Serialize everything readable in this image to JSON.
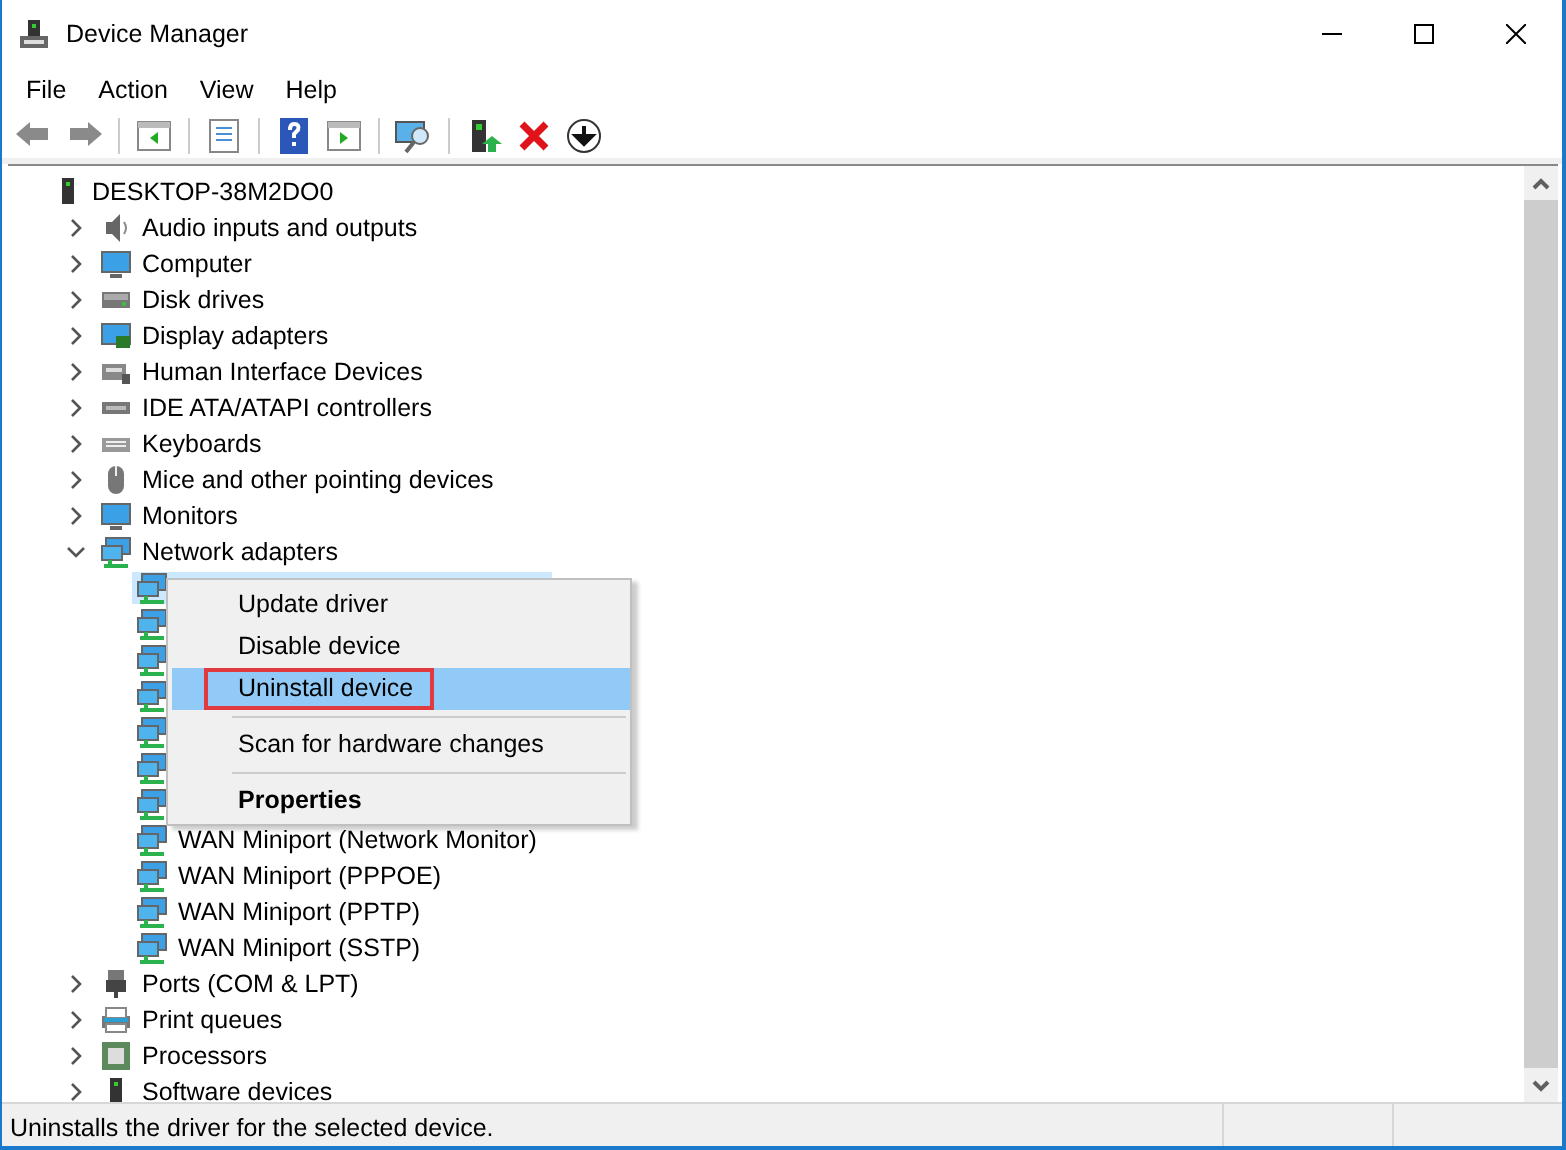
{
  "window": {
    "title": "Device Manager"
  },
  "menu": [
    "File",
    "Action",
    "View",
    "Help"
  ],
  "tree": {
    "label": "DESKTOP-38M2DO0",
    "children": [
      {
        "label": "Audio inputs and outputs",
        "expanded": false
      },
      {
        "label": "Computer",
        "expanded": false
      },
      {
        "label": "Disk drives",
        "expanded": false
      },
      {
        "label": "Display adapters",
        "expanded": false
      },
      {
        "label": "Human Interface Devices",
        "expanded": false
      },
      {
        "label": "IDE ATA/ATAPI controllers",
        "expanded": false
      },
      {
        "label": "Keyboards",
        "expanded": false
      },
      {
        "label": "Mice and other pointing devices",
        "expanded": false
      },
      {
        "label": "Monitors",
        "expanded": false
      },
      {
        "label": "Network adapters",
        "expanded": true,
        "children": [
          {
            "selected": true
          },
          {
            "selected": false
          },
          {
            "selected": false
          },
          {
            "selected": false
          },
          {
            "selected": false
          },
          {
            "selected": false
          },
          {
            "selected": false
          },
          {
            "label": "WAN Miniport (Network Monitor)",
            "selected": false
          },
          {
            "label": "WAN Miniport (PPPOE)",
            "selected": false
          },
          {
            "label": "WAN Miniport (PPTP)",
            "selected": false
          },
          {
            "label": "WAN Miniport (SSTP)",
            "selected": false
          }
        ]
      },
      {
        "label": "Ports (COM & LPT)",
        "expanded": false
      },
      {
        "label": "Print queues",
        "expanded": false
      },
      {
        "label": "Processors",
        "expanded": false
      },
      {
        "label": "Software devices",
        "expanded": false
      }
    ]
  },
  "context_menu": [
    {
      "kind": "item",
      "label": "Update driver",
      "selected": false
    },
    {
      "kind": "item",
      "label": "Disable device",
      "selected": false
    },
    {
      "kind": "item",
      "label": "Uninstall device",
      "selected": true,
      "outlined": true
    },
    {
      "kind": "separator"
    },
    {
      "kind": "item",
      "label": "Scan for hardware changes",
      "selected": false
    },
    {
      "kind": "separator"
    },
    {
      "kind": "item",
      "label": "Properties",
      "selected": false,
      "default": true
    }
  ],
  "status_bar": "Uninstalls the driver for the selected device."
}
